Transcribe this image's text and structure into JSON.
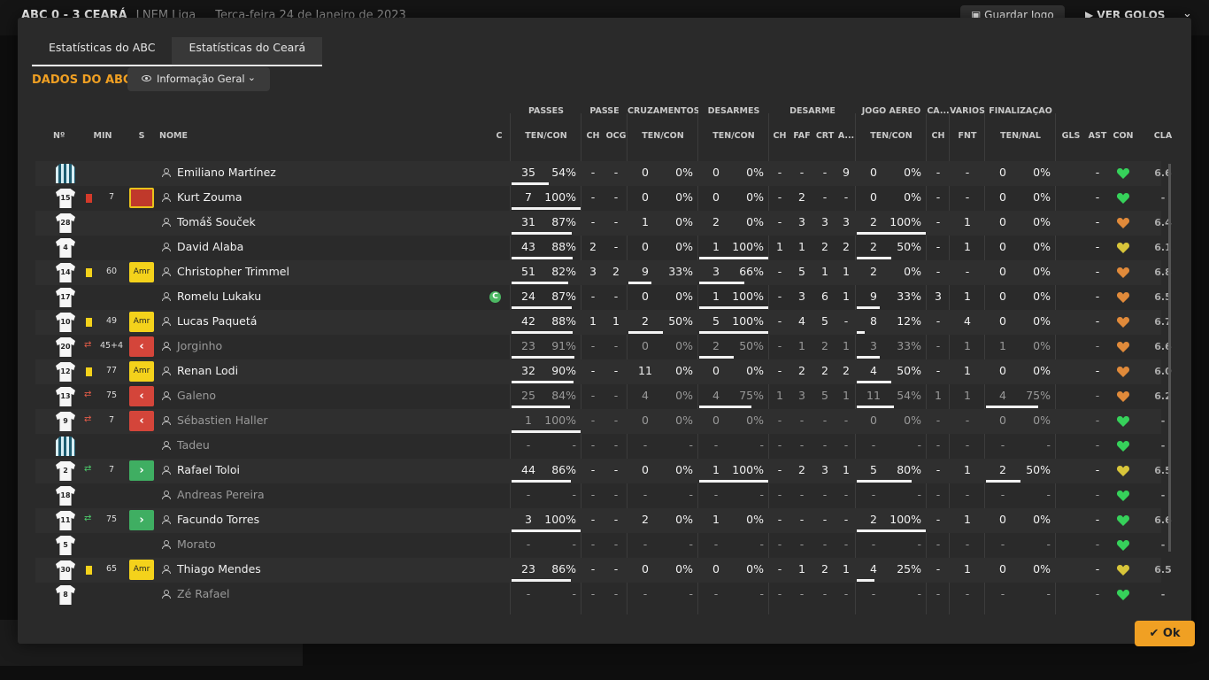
{
  "topbar": {
    "score": "ABC  0 - 3  CEARÁ",
    "league": "LNEM Liga",
    "date": "Terça-feira 24 de Janeiro de 2023",
    "save_label": "Guardar Jogo",
    "goals_label": "VER GOLOS"
  },
  "modal": {
    "tabs": [
      {
        "label": "Estatísticas do ABC",
        "active": true
      },
      {
        "label": "Estatísticas do Ceará",
        "active": false
      }
    ],
    "section_title": "DADOS DO ABC",
    "view_select": "Informação Geral",
    "ok_label": "Ok"
  },
  "groups": {
    "passes": "PASSES",
    "passe": "PASSE",
    "cruzamentos": "CRUZAMENTOS",
    "desarmes": "DESARMES",
    "desarme": "DESARME",
    "jogo_aereo": "JOGO AÉREO",
    "ca": "CA...",
    "varios": "VÁRIOS",
    "finalizacao": "FINALIZAÇÃO"
  },
  "columns": {
    "no": "Nº",
    "min": "MIN",
    "s": "S",
    "nome": "NOME",
    "c": "C",
    "pass_tc": "TEN/CON",
    "passe_ch": "CH",
    "passe_ocg": "OCG",
    "cruz_tc": "TEN/CON",
    "des_tc": "TEN/CON",
    "d_ch": "CH",
    "d_faf": "FAF",
    "d_crt": "CRT",
    "d_a": "A...",
    "aer_tc": "TEN/CON",
    "ca_ch": "CH",
    "var_fnt": "FNT",
    "fin_tn": "TEN/NAL",
    "gls": "GLS",
    "ast": "AST",
    "con": "CON",
    "cla": "CLA"
  },
  "players": [
    {
      "no": "",
      "gk": true,
      "card": "",
      "sub": "",
      "min": "",
      "badge": "",
      "name": "Emiliano Martínez",
      "captain": false,
      "dim": false,
      "pt": "35",
      "pp": "54%",
      "pbar": 0.54,
      "pch": "-",
      "pocg": "-",
      "ct": "0",
      "cp": "0%",
      "cbar": 0,
      "dt": "0",
      "dp": "0%",
      "dbar": 0,
      "dch": "-",
      "dfaf": "-",
      "dcrt": "-",
      "da": "9",
      "at": "0",
      "ap": "0%",
      "abar": 0,
      "cach": "-",
      "fnt": "-",
      "ft": "0",
      "fp": "0%",
      "fbar": 0,
      "gls": "",
      "ast": "-",
      "con": "green",
      "cla": "6.6"
    },
    {
      "no": "15",
      "gk": false,
      "card": "red",
      "sub": "",
      "min": "7",
      "badge": "red",
      "name": "Kurt Zouma",
      "captain": false,
      "dim": false,
      "pt": "7",
      "pp": "100%",
      "pbar": 1,
      "pch": "-",
      "pocg": "-",
      "ct": "0",
      "cp": "0%",
      "cbar": 0,
      "dt": "0",
      "dp": "0%",
      "dbar": 0,
      "dch": "-",
      "dfaf": "2",
      "dcrt": "-",
      "da": "-",
      "at": "0",
      "ap": "0%",
      "abar": 0,
      "cach": "-",
      "fnt": "-",
      "ft": "0",
      "fp": "0%",
      "fbar": 0,
      "gls": "",
      "ast": "-",
      "con": "green",
      "cla": "-"
    },
    {
      "no": "28",
      "gk": false,
      "card": "",
      "sub": "",
      "min": "",
      "badge": "",
      "name": "Tomáš Souček",
      "captain": false,
      "dim": false,
      "pt": "31",
      "pp": "87%",
      "pbar": 0.87,
      "pch": "-",
      "pocg": "-",
      "ct": "1",
      "cp": "0%",
      "cbar": 0,
      "dt": "2",
      "dp": "0%",
      "dbar": 0,
      "dch": "-",
      "dfaf": "3",
      "dcrt": "3",
      "da": "3",
      "at": "2",
      "ap": "100%",
      "abar": 1,
      "cach": "-",
      "fnt": "1",
      "ft": "0",
      "fp": "0%",
      "fbar": 0,
      "gls": "",
      "ast": "-",
      "con": "orange",
      "cla": "6.4"
    },
    {
      "no": "4",
      "gk": false,
      "card": "",
      "sub": "",
      "min": "",
      "badge": "",
      "name": "David Alaba",
      "captain": false,
      "dim": false,
      "pt": "43",
      "pp": "88%",
      "pbar": 0.88,
      "pch": "2",
      "pocg": "-",
      "ct": "0",
      "cp": "0%",
      "cbar": 0,
      "dt": "1",
      "dp": "100%",
      "dbar": 1,
      "dch": "1",
      "dfaf": "1",
      "dcrt": "2",
      "da": "2",
      "at": "2",
      "ap": "50%",
      "abar": 0.5,
      "cach": "-",
      "fnt": "1",
      "ft": "0",
      "fp": "0%",
      "fbar": 0,
      "gls": "",
      "ast": "-",
      "con": "yellow",
      "cla": "6.1"
    },
    {
      "no": "14",
      "gk": false,
      "card": "yellow",
      "sub": "",
      "min": "60",
      "badge": "amr",
      "name": "Christopher Trimmel",
      "captain": false,
      "dim": false,
      "pt": "51",
      "pp": "82%",
      "pbar": 0.82,
      "pch": "3",
      "pocg": "2",
      "ct": "9",
      "cp": "33%",
      "cbar": 0.33,
      "dt": "3",
      "dp": "66%",
      "dbar": 0.66,
      "dch": "-",
      "dfaf": "5",
      "dcrt": "1",
      "da": "1",
      "at": "2",
      "ap": "0%",
      "abar": 0,
      "cach": "-",
      "fnt": "-",
      "ft": "0",
      "fp": "0%",
      "fbar": 0,
      "gls": "",
      "ast": "-",
      "con": "orange",
      "cla": "6.8"
    },
    {
      "no": "17",
      "gk": false,
      "card": "",
      "sub": "",
      "min": "",
      "badge": "",
      "name": "Romelu Lukaku",
      "captain": true,
      "dim": false,
      "pt": "24",
      "pp": "87%",
      "pbar": 0.87,
      "pch": "-",
      "pocg": "-",
      "ct": "0",
      "cp": "0%",
      "cbar": 0,
      "dt": "1",
      "dp": "100%",
      "dbar": 1,
      "dch": "-",
      "dfaf": "3",
      "dcrt": "6",
      "da": "1",
      "at": "9",
      "ap": "33%",
      "abar": 0.33,
      "cach": "3",
      "fnt": "1",
      "ft": "0",
      "fp": "0%",
      "fbar": 0,
      "gls": "",
      "ast": "-",
      "con": "orange",
      "cla": "6.5"
    },
    {
      "no": "10",
      "gk": false,
      "card": "yellow",
      "sub": "",
      "min": "49",
      "badge": "amr",
      "name": "Lucas Paquetá",
      "captain": false,
      "dim": false,
      "pt": "42",
      "pp": "88%",
      "pbar": 0.88,
      "pch": "1",
      "pocg": "1",
      "ct": "2",
      "cp": "50%",
      "cbar": 0.5,
      "dt": "5",
      "dp": "100%",
      "dbar": 1,
      "dch": "-",
      "dfaf": "4",
      "dcrt": "5",
      "da": "-",
      "at": "8",
      "ap": "12%",
      "abar": 0.12,
      "cach": "-",
      "fnt": "4",
      "ft": "0",
      "fp": "0%",
      "fbar": 0,
      "gls": "",
      "ast": "-",
      "con": "orange",
      "cla": "6.7"
    },
    {
      "no": "20",
      "gk": false,
      "card": "",
      "sub": "out",
      "min": "45+4",
      "badge": "out",
      "name": "Jorginho",
      "captain": false,
      "dim": true,
      "pt": "23",
      "pp": "91%",
      "pbar": 0.91,
      "pch": "-",
      "pocg": "-",
      "ct": "0",
      "cp": "0%",
      "cbar": 0,
      "dt": "2",
      "dp": "50%",
      "dbar": 0.5,
      "dch": "-",
      "dfaf": "1",
      "dcrt": "2",
      "da": "1",
      "at": "3",
      "ap": "33%",
      "abar": 0.33,
      "cach": "-",
      "fnt": "1",
      "ft": "1",
      "fp": "0%",
      "fbar": 0,
      "gls": "",
      "ast": "-",
      "con": "orange",
      "cla": "6.6"
    },
    {
      "no": "12",
      "gk": false,
      "card": "yellow",
      "sub": "",
      "min": "77",
      "badge": "amr",
      "name": "Renan Lodi",
      "captain": false,
      "dim": false,
      "pt": "32",
      "pp": "90%",
      "pbar": 0.9,
      "pch": "-",
      "pocg": "-",
      "ct": "11",
      "cp": "0%",
      "cbar": 0,
      "dt": "0",
      "dp": "0%",
      "dbar": 0,
      "dch": "-",
      "dfaf": "2",
      "dcrt": "2",
      "da": "2",
      "at": "4",
      "ap": "50%",
      "abar": 0.5,
      "cach": "-",
      "fnt": "1",
      "ft": "0",
      "fp": "0%",
      "fbar": 0,
      "gls": "",
      "ast": "-",
      "con": "orange",
      "cla": "6.0"
    },
    {
      "no": "13",
      "gk": false,
      "card": "",
      "sub": "out",
      "min": "75",
      "badge": "out",
      "name": "Galeno",
      "captain": false,
      "dim": true,
      "pt": "25",
      "pp": "84%",
      "pbar": 0.84,
      "pch": "-",
      "pocg": "-",
      "ct": "4",
      "cp": "0%",
      "cbar": 0,
      "dt": "4",
      "dp": "75%",
      "dbar": 0.75,
      "dch": "1",
      "dfaf": "3",
      "dcrt": "5",
      "da": "1",
      "at": "11",
      "ap": "54%",
      "abar": 0.54,
      "cach": "1",
      "fnt": "1",
      "ft": "4",
      "fp": "75%",
      "fbar": 0.75,
      "gls": "",
      "ast": "-",
      "con": "orange",
      "cla": "6.2"
    },
    {
      "no": "9",
      "gk": false,
      "card": "",
      "sub": "out",
      "min": "7",
      "badge": "out",
      "name": "Sébastien Haller",
      "captain": false,
      "dim": true,
      "pt": "1",
      "pp": "100%",
      "pbar": 1,
      "pch": "-",
      "pocg": "-",
      "ct": "0",
      "cp": "0%",
      "cbar": 0,
      "dt": "0",
      "dp": "0%",
      "dbar": 0,
      "dch": "-",
      "dfaf": "-",
      "dcrt": "-",
      "da": "-",
      "at": "0",
      "ap": "0%",
      "abar": 0,
      "cach": "-",
      "fnt": "-",
      "ft": "0",
      "fp": "0%",
      "fbar": 0,
      "gls": "",
      "ast": "-",
      "con": "green",
      "cla": "-"
    },
    {
      "no": "",
      "gk": true,
      "card": "",
      "sub": "",
      "min": "",
      "badge": "",
      "name": "Tadeu",
      "captain": false,
      "dim": true,
      "pt": "-",
      "pp": "-",
      "pbar": 0,
      "pch": "-",
      "pocg": "-",
      "ct": "-",
      "cp": "-",
      "cbar": 0,
      "dt": "-",
      "dp": "-",
      "dbar": 0,
      "dch": "-",
      "dfaf": "-",
      "dcrt": "-",
      "da": "-",
      "at": "-",
      "ap": "-",
      "abar": 0,
      "cach": "-",
      "fnt": "-",
      "ft": "-",
      "fp": "-",
      "fbar": 0,
      "gls": "",
      "ast": "-",
      "con": "green",
      "cla": "-"
    },
    {
      "no": "2",
      "gk": false,
      "card": "",
      "sub": "in",
      "min": "7",
      "badge": "in",
      "name": "Rafael Toloi",
      "captain": false,
      "dim": false,
      "pt": "44",
      "pp": "86%",
      "pbar": 0.86,
      "pch": "-",
      "pocg": "-",
      "ct": "0",
      "cp": "0%",
      "cbar": 0,
      "dt": "1",
      "dp": "100%",
      "dbar": 1,
      "dch": "-",
      "dfaf": "2",
      "dcrt": "3",
      "da": "1",
      "at": "5",
      "ap": "80%",
      "abar": 0.8,
      "cach": "-",
      "fnt": "1",
      "ft": "2",
      "fp": "50%",
      "fbar": 0.5,
      "gls": "",
      "ast": "-",
      "con": "yellow",
      "cla": "6.5"
    },
    {
      "no": "18",
      "gk": false,
      "card": "",
      "sub": "",
      "min": "",
      "badge": "",
      "name": "Andreas Pereira",
      "captain": false,
      "dim": true,
      "pt": "-",
      "pp": "-",
      "pbar": 0,
      "pch": "-",
      "pocg": "-",
      "ct": "-",
      "cp": "-",
      "cbar": 0,
      "dt": "-",
      "dp": "-",
      "dbar": 0,
      "dch": "-",
      "dfaf": "-",
      "dcrt": "-",
      "da": "-",
      "at": "-",
      "ap": "-",
      "abar": 0,
      "cach": "-",
      "fnt": "-",
      "ft": "-",
      "fp": "-",
      "fbar": 0,
      "gls": "",
      "ast": "-",
      "con": "green",
      "cla": "-"
    },
    {
      "no": "11",
      "gk": false,
      "card": "",
      "sub": "in",
      "min": "75",
      "badge": "in",
      "name": "Facundo Torres",
      "captain": false,
      "dim": false,
      "pt": "3",
      "pp": "100%",
      "pbar": 1,
      "pch": "-",
      "pocg": "-",
      "ct": "2",
      "cp": "0%",
      "cbar": 0,
      "dt": "1",
      "dp": "0%",
      "dbar": 0,
      "dch": "-",
      "dfaf": "-",
      "dcrt": "-",
      "da": "-",
      "at": "2",
      "ap": "100%",
      "abar": 1,
      "cach": "-",
      "fnt": "1",
      "ft": "0",
      "fp": "0%",
      "fbar": 0,
      "gls": "",
      "ast": "-",
      "con": "green",
      "cla": "6.6"
    },
    {
      "no": "5",
      "gk": false,
      "card": "",
      "sub": "",
      "min": "",
      "badge": "",
      "name": "Morato",
      "captain": false,
      "dim": true,
      "pt": "-",
      "pp": "-",
      "pbar": 0,
      "pch": "-",
      "pocg": "-",
      "ct": "-",
      "cp": "-",
      "cbar": 0,
      "dt": "-",
      "dp": "-",
      "dbar": 0,
      "dch": "-",
      "dfaf": "-",
      "dcrt": "-",
      "da": "-",
      "at": "-",
      "ap": "-",
      "abar": 0,
      "cach": "-",
      "fnt": "-",
      "ft": "-",
      "fp": "-",
      "fbar": 0,
      "gls": "",
      "ast": "-",
      "con": "green",
      "cla": "-"
    },
    {
      "no": "30",
      "gk": false,
      "card": "yellow",
      "sub": "",
      "min": "65",
      "badge": "amr",
      "name": "Thiago Mendes",
      "captain": false,
      "dim": false,
      "pt": "23",
      "pp": "86%",
      "pbar": 0.86,
      "pch": "-",
      "pocg": "-",
      "ct": "0",
      "cp": "0%",
      "cbar": 0,
      "dt": "0",
      "dp": "0%",
      "dbar": 0,
      "dch": "-",
      "dfaf": "1",
      "dcrt": "2",
      "da": "1",
      "at": "4",
      "ap": "25%",
      "abar": 0.25,
      "cach": "-",
      "fnt": "1",
      "ft": "0",
      "fp": "0%",
      "fbar": 0,
      "gls": "",
      "ast": "-",
      "con": "yellow",
      "cla": "6.5"
    },
    {
      "no": "8",
      "gk": false,
      "card": "",
      "sub": "",
      "min": "",
      "badge": "",
      "name": "Zé Rafael",
      "captain": false,
      "dim": true,
      "pt": "-",
      "pp": "-",
      "pbar": 0,
      "pch": "-",
      "pocg": "-",
      "ct": "-",
      "cp": "-",
      "cbar": 0,
      "dt": "-",
      "dp": "-",
      "dbar": 0,
      "dch": "-",
      "dfaf": "-",
      "dcrt": "-",
      "da": "-",
      "at": "-",
      "ap": "-",
      "abar": 0,
      "cach": "-",
      "fnt": "-",
      "ft": "-",
      "fp": "-",
      "fbar": 0,
      "gls": "",
      "ast": "-",
      "con": "green",
      "cla": "-"
    }
  ],
  "badge_labels": {
    "amr": "Amr",
    "captain": "C"
  },
  "colors": {
    "accent": "#f0a023",
    "yellow_card": "#f4d21b",
    "red_card": "#d43a2a",
    "sub_in": "#3fae62",
    "sub_out": "#d4453a",
    "morale_green": "#36d15a",
    "morale_orange": "#e08a3a",
    "morale_yellow": "#d8c53a"
  }
}
